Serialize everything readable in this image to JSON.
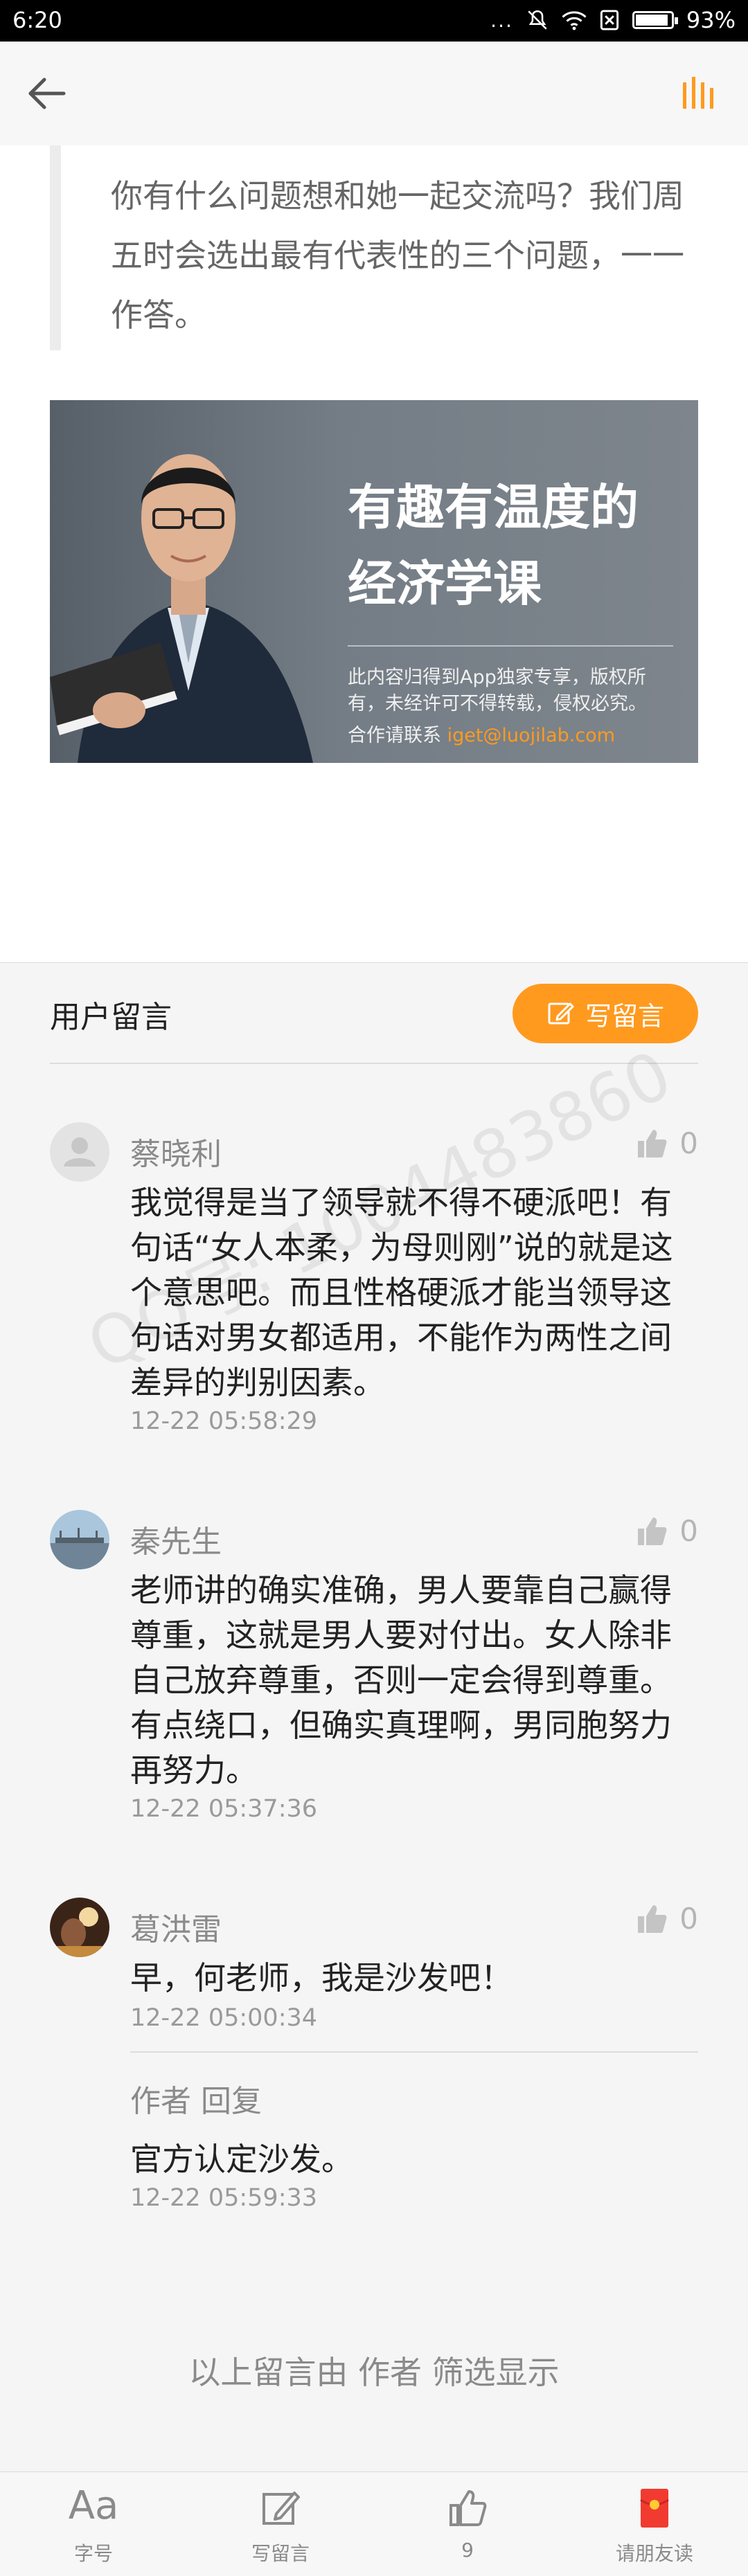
{
  "status_bar": {
    "time": "6:20",
    "battery": "93%",
    "battery_level": 0.93,
    "dots": "..."
  },
  "top_bar": {
    "back_icon": "arrow-left-icon",
    "audio_icon": "audio-bars-icon",
    "accent": "#ff9a1f"
  },
  "article": {
    "quote": "你有什么问题想和她一起交流吗？我们周五时会选出最有代表性的三个问题，一一作答。",
    "banner": {
      "title_line1": "有趣有温度的",
      "title_line2": "经济学课",
      "copyright": "此内容归得到App独家专享，版权所有，未经许可不得转载，侵权必究。",
      "contact_label": "合作请联系",
      "contact_email": "iget@luojilab.com"
    }
  },
  "comments_section": {
    "title": "用户留言",
    "write_button": "写留言",
    "comments": [
      {
        "name": "蔡晓利",
        "likes": "0",
        "text": "我觉得是当了领导就不得不硬派吧！有句话“女人本柔，为母则刚”说的就是这个意思吧。而且性格硬派才能当领导这句话对男女都适用，不能作为两性之间差异的判别因素。",
        "time": "12-22 05:58:29"
      },
      {
        "name": "秦先生",
        "likes": "0",
        "text": "老师讲的确实准确，男人要靠自己赢得尊重，这就是男人要对付出。女人除非自己放弃尊重，否则一定会得到尊重。有点绕口，但确实真理啊，男同胞努力再努力。",
        "time": "12-22 05:37:36"
      },
      {
        "name": "葛洪雷",
        "likes": "0",
        "text": "早，何老师，我是沙发吧！",
        "time": "12-22 05:00:34",
        "reply": {
          "author": "作者 回复",
          "text": "官方认定沙发。",
          "time": "12-22 05:59:33"
        }
      }
    ],
    "footer_note": "以上留言由 作者 筛选显示",
    "watermark": "QQ号: 1004483860"
  },
  "bottom_bar": {
    "tabs": [
      {
        "label": "字号",
        "icon": "font-size-icon",
        "glyph": "Aa"
      },
      {
        "label": "写留言",
        "icon": "edit-icon"
      },
      {
        "label": "9",
        "icon": "thumbs-up-icon"
      },
      {
        "label": "请朋友读",
        "icon": "red-envelope-icon"
      }
    ]
  }
}
